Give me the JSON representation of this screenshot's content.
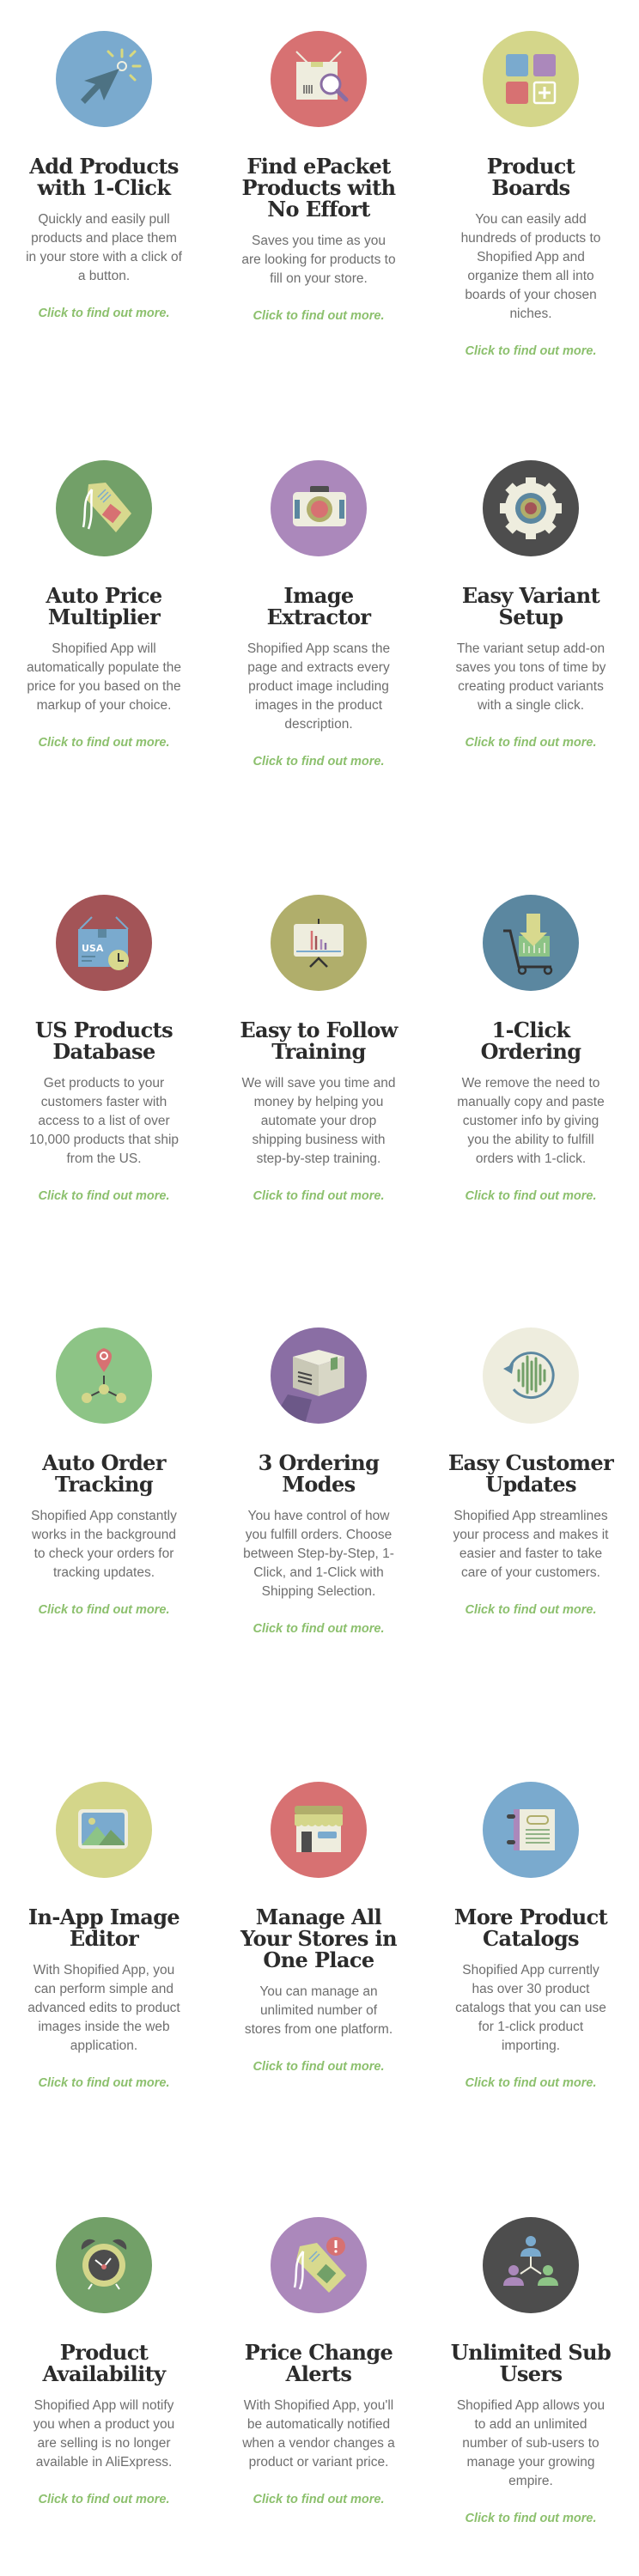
{
  "link_label": "Click to find out more.",
  "colors": {
    "title": "#2b2b2b",
    "body": "#6e6e6e",
    "link": "#8cc06d"
  },
  "features": [
    {
      "title": "Add Products with 1-Click",
      "description": "Quickly and easily pull products and place them in your store with a click of a button.",
      "icon": "cursor-click-icon",
      "icon_bg": "#7aaace",
      "link": "Click to find out more."
    },
    {
      "title": "Find ePacket Products with No Effort",
      "description": "Saves you time as you are looking for products to fill on your store.",
      "icon": "package-search-icon",
      "icon_bg": "#d77172",
      "link": "Click to find out more."
    },
    {
      "title": "Product Boards",
      "description": "You can easily add hundreds of products to Shopified App and organize them all into boards of your chosen niches.",
      "icon": "boards-grid-icon",
      "icon_bg": "#d4d68a",
      "link": "Click to find out more."
    },
    {
      "title": "Auto Price Multiplier",
      "description": "Shopified App will automatically populate the price for you based on the markup of your choice.",
      "icon": "price-tag-icon",
      "icon_bg": "#72a068",
      "link": "Click to find out more."
    },
    {
      "title": "Image Extractor",
      "description": "Shopified App scans the page and extracts every product image including images in the product description.",
      "icon": "camera-icon",
      "icon_bg": "#ab88bb",
      "link": "Click to find out more."
    },
    {
      "title": "Easy Variant Setup",
      "description": "The variant setup add-on saves you tons of time by creating product variants with a single click.",
      "icon": "gear-icon",
      "icon_bg": "#4d4d4d",
      "link": "Click to find out more."
    },
    {
      "title": "US Products Database",
      "description": "Get products to your customers faster with access to a list of over 10,000 products that ship from the US.",
      "icon": "usa-box-clock-icon",
      "icon_bg": "#a35457",
      "link": "Click to find out more."
    },
    {
      "title": "Easy to Follow Training",
      "description": "We will save you time and money by helping you automate your drop shipping business with step-by-step training.",
      "icon": "presentation-board-icon",
      "icon_bg": "#b0ae6b",
      "link": "Click to find out more."
    },
    {
      "title": "1-Click Ordering",
      "description": "We remove the need to manually copy and paste customer info by giving you the ability to fulfill orders with 1-click.",
      "icon": "cart-download-icon",
      "icon_bg": "#5b87a0",
      "link": "Click to find out more."
    },
    {
      "title": "Auto Order Tracking",
      "description": "Shopified App constantly works in the background to check your orders for tracking updates.",
      "icon": "location-pin-network-icon",
      "icon_bg": "#8dc486",
      "link": "Click to find out more."
    },
    {
      "title": "3 Ordering Modes",
      "description": "You have control of how you fulfill orders. Choose between Step-by-Step, 1-Click, and 1-Click with Shipping Selection.",
      "icon": "box-icon",
      "icon_bg": "#8a6ea4",
      "link": "Click to find out more."
    },
    {
      "title": "Easy Customer Updates",
      "description": "Shopified App streamlines your process and makes it easier and faster to take care of your customers.",
      "icon": "refresh-soundwave-icon",
      "icon_bg": "#eeedde",
      "link": "Click to find out more."
    },
    {
      "title": "In-App Image Editor",
      "description": "With Shopified App, you can perform simple and advanced edits to product images inside the web application.",
      "icon": "image-landscape-icon",
      "icon_bg": "#d4d68a",
      "link": "Click to find out more."
    },
    {
      "title": "Manage All Your Stores in One Place",
      "description": "You can manage an unlimited number of stores from one platform.",
      "icon": "storefront-icon",
      "icon_bg": "#d77172",
      "link": "Click to find out more."
    },
    {
      "title": "More Product Catalogs",
      "description": "Shopified App currently has over 30 product catalogs that you can use for 1-click product importing.",
      "icon": "notebook-icon",
      "icon_bg": "#7aaace",
      "link": "Click to find out more."
    },
    {
      "title": "Product Availability",
      "description": "Shopified App will notify you when a product you are selling is no longer available in AliExpress.",
      "icon": "alarm-clock-icon",
      "icon_bg": "#72a068",
      "link": "Click to find out more."
    },
    {
      "title": "Price Change Alerts",
      "description": "With Shopified App, you'll be automatically notified when a vendor changes a product or variant price.",
      "icon": "price-tag-alert-icon",
      "icon_bg": "#ab88bb",
      "link": "Click to find out more."
    },
    {
      "title": "Unlimited Sub Users",
      "description": "Shopified App allows you to add an unlimited number of sub-users to manage your growing empire.",
      "icon": "users-network-icon",
      "icon_bg": "#4d4d4d",
      "link": "Click to find out more."
    }
  ]
}
